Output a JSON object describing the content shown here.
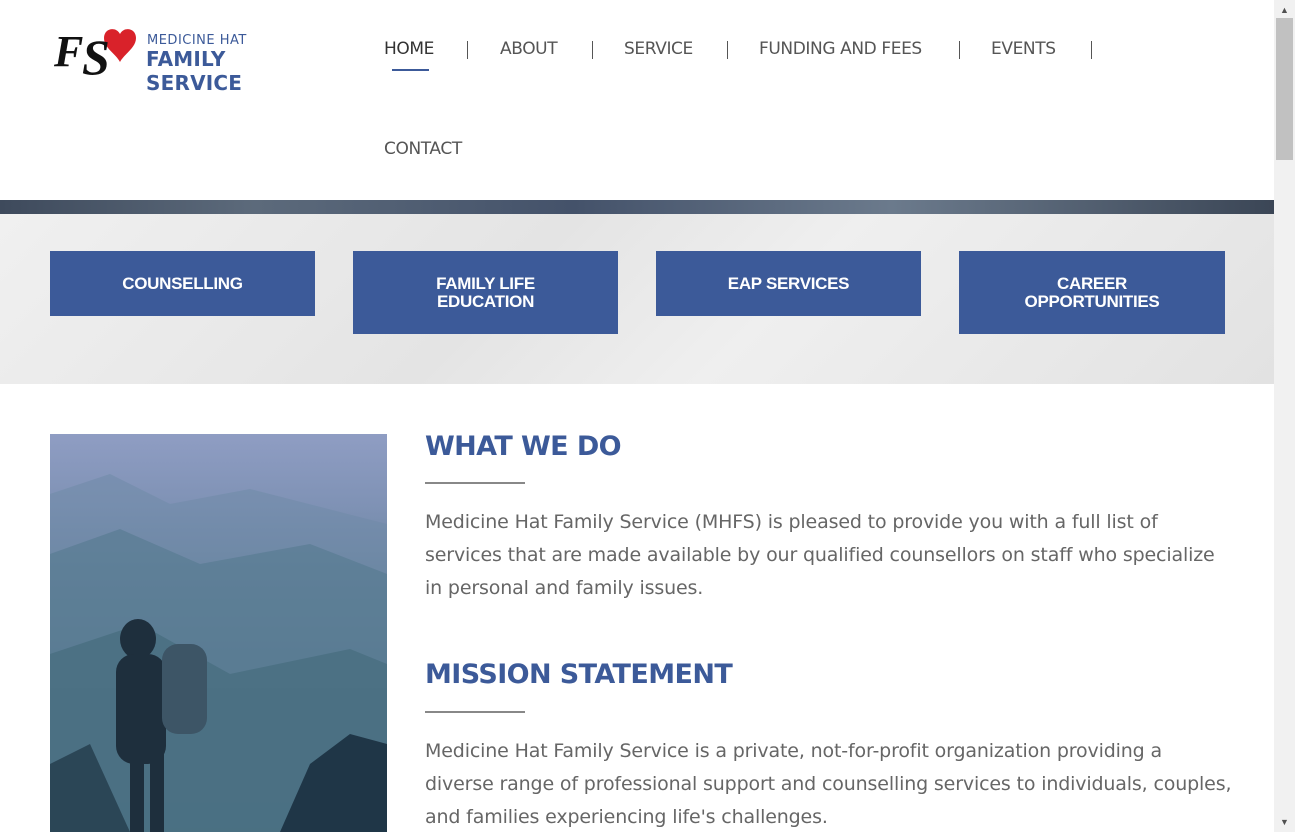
{
  "brand": {
    "logo_initials": "FS",
    "logo_line1": "MEDICINE HAT",
    "logo_line2": "FAMILY SERVICE",
    "primary_color": "#3c5a99",
    "heart_color": "#d9222a"
  },
  "nav": {
    "items": [
      {
        "label": "HOME",
        "active": true
      },
      {
        "label": "ABOUT"
      },
      {
        "label": "SERVICE"
      },
      {
        "label": "FUNDING AND FEES"
      },
      {
        "label": "EVENTS"
      },
      {
        "label": "CONTACT"
      }
    ]
  },
  "services": [
    {
      "label": "COUNSELLING"
    },
    {
      "label": "FAMILY LIFE EDUCATION"
    },
    {
      "label": "EAP SERVICES"
    },
    {
      "label": "CAREER OPPORTUNITIES"
    }
  ],
  "content": {
    "what_we_do": {
      "title": "WHAT WE DO",
      "text": "Medicine Hat Family Service (MHFS) is pleased to provide you with a full list of services that are made available by our qualified counsellors on staff who specialize in personal and family issues."
    },
    "mission": {
      "title": "MISSION STATEMENT",
      "text": "Medicine Hat Family Service is a private, not-for-profit organization providing a diverse range of professional support and counselling services to individuals, couples, and families experiencing life's challenges."
    }
  },
  "scrollbar": {
    "up_icon": "scroll-up-arrow",
    "down_icon": "scroll-down-arrow"
  }
}
